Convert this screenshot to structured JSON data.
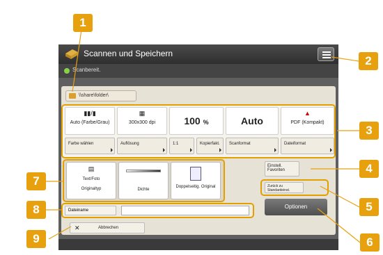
{
  "window": {
    "title": "Scannen und Speichern"
  },
  "status": {
    "text": "Scanbereit."
  },
  "destination": {
    "path": "\\\\share\\folder\\"
  },
  "settings": {
    "color_mode": "Auto (Farbe/Grau)",
    "resolution": "300x300 dpi",
    "zoom_value": "100",
    "zoom_unit": "%",
    "scan_size": "Auto",
    "file_format": "PDF (Kompakt)",
    "functions": [
      "Farbe wählen",
      "Auflösung",
      "1:1",
      "Kopierfakt.",
      "Scanformat",
      "Dateiformat"
    ]
  },
  "options": {
    "text_photo": "Text/Foto",
    "original_type": "Originaltyp",
    "density": "Dichte",
    "duplex": "Doppelseitig. Original"
  },
  "side": {
    "favorites": "Einstell. Favoriten",
    "reset": "Zurück zu Standardeinst.",
    "options_button": "Optionen"
  },
  "file_name": {
    "label": "Dateiname",
    "value": ""
  },
  "cancel": {
    "label": "Abbrechen"
  },
  "callouts": [
    "1",
    "2",
    "3",
    "4",
    "5",
    "6",
    "7",
    "8",
    "9"
  ],
  "colors": {
    "accent": "#e7a10e",
    "panel": "#e7e2d6",
    "titlebar": "#3a3a3a"
  }
}
